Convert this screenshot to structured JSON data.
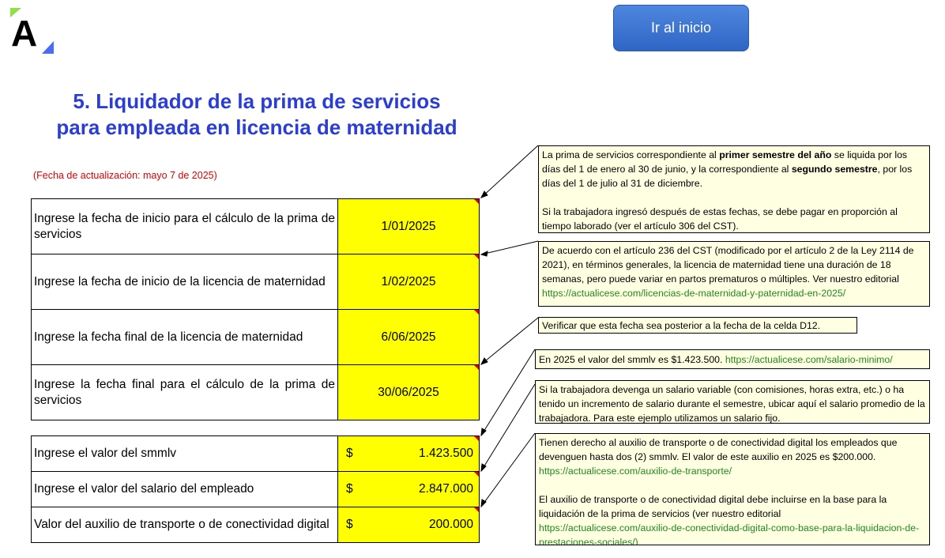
{
  "header": {
    "logo_letter": "A",
    "home_button": "Ir al inicio"
  },
  "title": {
    "line1": "5. Liquidador de la prima de servicios",
    "line2": "para empleada en licencia de maternidad"
  },
  "update_note": "(Fecha de actualización: mayo 7 de 2025)",
  "date_rows": [
    {
      "label": "Ingrese la fecha de inicio para el cálculo de la prima de servicios",
      "value": "1/01/2025"
    },
    {
      "label": "Ingrese la fecha de inicio de la licencia de maternidad",
      "value": "1/02/2025"
    },
    {
      "label": "Ingrese la fecha final de la licencia de maternidad",
      "value": "6/06/2025"
    },
    {
      "label": "Ingrese la fecha final para el cálculo de la prima de servicios",
      "value": "30/06/2025"
    }
  ],
  "money_rows": [
    {
      "label": "Ingrese el valor del smmlv",
      "currency": "$",
      "value": "1.423.500"
    },
    {
      "label": "Ingrese el valor del salario del empleado",
      "currency": "$",
      "value": "2.847.000"
    },
    {
      "label": "Valor del auxilio de transporte o de conectividad digital",
      "currency": "$",
      "value": "200.000"
    }
  ],
  "notes": {
    "n1": {
      "t1": "La prima de servicios correspondiente al ",
      "b1": "primer semestre del año",
      "t2": " se liquida por los días del 1 de enero al 30 de junio, y la correspondiente al ",
      "b2": "segundo semestre",
      "t3": ", por los días del 1 de julio al 31 de diciembre.",
      "p2": "Si la trabajadora ingresó después de estas fechas, se debe pagar en proporción al tiempo laborado (ver el artículo 306 del CST)."
    },
    "n2": {
      "text": "De acuerdo con el artículo 236 del CST (modificado por el artículo 2 de la Ley 2114 de 2021), en términos generales, la licencia de maternidad tiene una duración de 18 semanas, pero puede variar en partos prematuros o múltiples. Ver nuestro editorial",
      "link": "https://actualicese.com/licencias-de-maternidad-y-paternidad-en-2025/"
    },
    "n3": {
      "text": "Verificar que esta fecha sea posterior a la fecha de la celda D12."
    },
    "n4": {
      "text": "En 2025 el valor del smmlv es $1.423.500. ",
      "link": "https://actualicese.com/salario-minimo/"
    },
    "n5": {
      "text": "Si la trabajadora devenga un salario variable (con comisiones, horas extra, etc.) o ha tenido un incremento de salario durante el semestre, ubicar aquí el salario promedio de la trabajadora. Para este ejemplo utilizamos un salario fijo."
    },
    "n6": {
      "text1": "Tienen derecho al auxilio de transporte o de conectividad digital los empleados que devenguen hasta dos (2) smmlv. El valor de este auxilio en 2025 es $200.000.",
      "link1": "https://actualicese.com/auxilio-de-transporte/",
      "text2": "El auxilio de transporte o de conectividad digital debe incluirse en la base para la liquidación de la prima de servicios (ver nuestro editorial",
      "link2": "https://actualicese.com/auxilio-de-conectividad-digital-como-base-para-la-liquidacion-de-prestaciones-sociales/)"
    }
  },
  "colors": {
    "title": "#2a3ed6",
    "input_fill": "#ffff00",
    "note_fill": "#ffffe1",
    "link": "#1f8a1f",
    "update_note": "#e00000",
    "button": "#3a72d2"
  }
}
